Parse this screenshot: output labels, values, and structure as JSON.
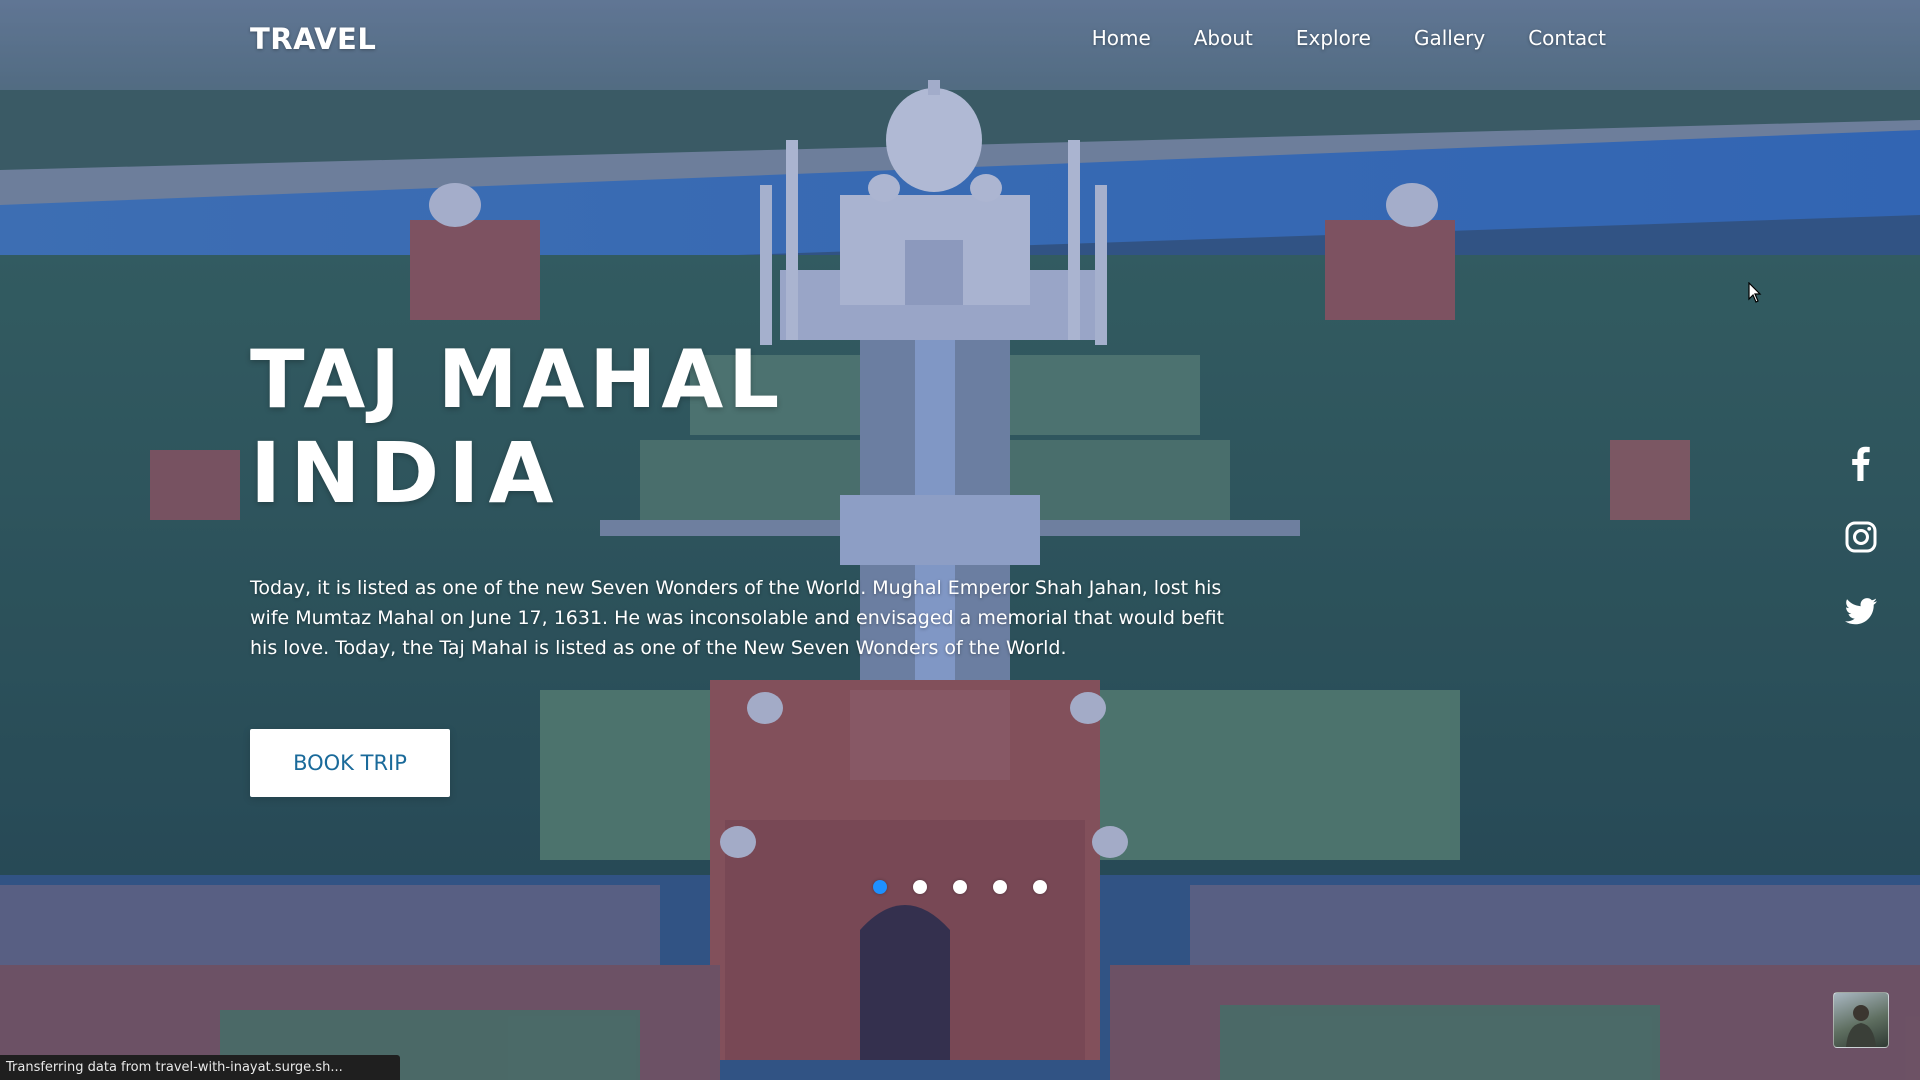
{
  "nav": {
    "logo": "TRAVEL",
    "links": [
      "Home",
      "About",
      "Explore",
      "Gallery",
      "Contact"
    ]
  },
  "hero": {
    "title": "TAJ MAHAL",
    "subtitle": "INDIA",
    "description": "Today, it is listed as one of the new Seven Wonders of the World. Mughal Emperor Shah Jahan, lost his wife Mumtaz Mahal on June 17, 1631. He was inconsolable and envisaged a memorial that would befit his love. Today, the Taj Mahal is listed as one of the New Seven Wonders of the World.",
    "button_label": "BOOK TRIP"
  },
  "social": [
    "facebook-icon",
    "instagram-icon",
    "twitter-icon"
  ],
  "slider": {
    "count": 5,
    "active_index": 0,
    "active_color": "#1e90ff"
  },
  "status_bar": "Transferring data from travel-with-inayat.surge.sh...",
  "colors": {
    "button_text": "#1a6a9a",
    "overlay": "#1e3782"
  }
}
